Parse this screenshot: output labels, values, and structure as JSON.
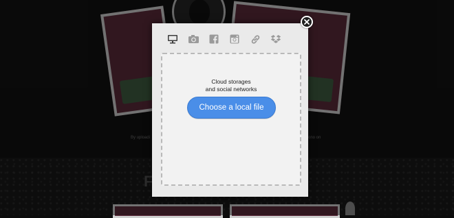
{
  "background": {
    "text_left": "By uploadi",
    "text_right": "ono on",
    "heading": "F"
  },
  "modal": {
    "close_icon": "close-icon",
    "tabs": [
      {
        "id": "local",
        "icon": "computer-icon",
        "active": true
      },
      {
        "id": "camera",
        "icon": "camera-icon",
        "active": false
      },
      {
        "id": "facebook",
        "icon": "facebook-icon",
        "active": false
      },
      {
        "id": "instagram",
        "icon": "instagram-icon",
        "active": false
      },
      {
        "id": "link",
        "icon": "link-icon",
        "active": false
      },
      {
        "id": "dropbox",
        "icon": "dropbox-icon",
        "active": false
      }
    ],
    "dropzone": {
      "line1": "Cloud storages",
      "line2": "and social networks",
      "choose_button": "Choose a local file"
    }
  },
  "colors": {
    "accent": "#4a8ee8",
    "icon_active": "#3c3c3c",
    "icon_inactive": "#9a9a9a"
  }
}
